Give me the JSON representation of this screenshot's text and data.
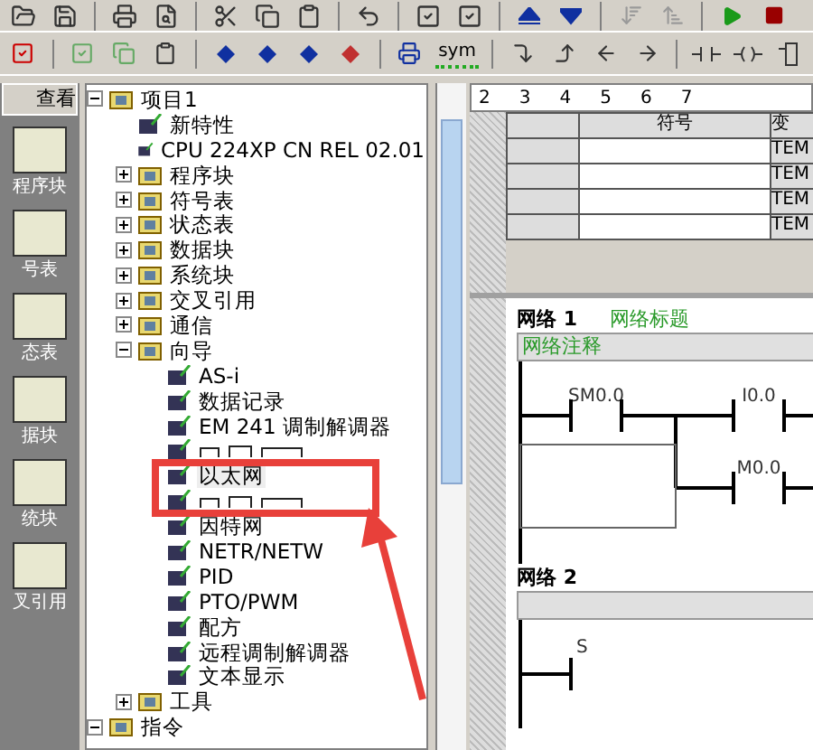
{
  "toolbar": {
    "sym_label": "sym"
  },
  "nav_bar": {
    "header": "查看",
    "items": [
      {
        "label": "程序块"
      },
      {
        "label": "号表"
      },
      {
        "label": "态表"
      },
      {
        "label": "据块"
      },
      {
        "label": "统块"
      },
      {
        "label": "叉引用"
      }
    ]
  },
  "tree": [
    {
      "label": "项目1",
      "expanded": true,
      "children": [
        {
          "label": "新特性"
        },
        {
          "label": "CPU 224XP CN REL 02.01"
        },
        {
          "label": "程序块",
          "expanded": false
        },
        {
          "label": "符号表",
          "expanded": false
        },
        {
          "label": "状态表",
          "expanded": false
        },
        {
          "label": "数据块",
          "expanded": false
        },
        {
          "label": "系统块",
          "expanded": false
        },
        {
          "label": "交叉引用",
          "expanded": false
        },
        {
          "label": "通信",
          "expanded": false
        },
        {
          "label": "向导",
          "expanded": true,
          "children": [
            {
              "label": "AS-i"
            },
            {
              "label": "数据记录"
            },
            {
              "label": "EM 241 调制解调器"
            },
            {
              "kind": "covered"
            },
            {
              "label": "以太网",
              "highlighted": true
            },
            {
              "kind": "covered"
            },
            {
              "label": "因特网"
            },
            {
              "label": "NETR/NETW"
            },
            {
              "label": "PID"
            },
            {
              "label": "PTO/PWM"
            },
            {
              "label": "配方"
            },
            {
              "label": "远程调制解调器"
            },
            {
              "label": "文本显示"
            }
          ]
        },
        {
          "label": "工具",
          "expanded": false
        }
      ]
    },
    {
      "label": "指令",
      "expanded": true
    }
  ],
  "ruler": {
    "ticks": [
      "2",
      "3",
      "4",
      "5",
      "6",
      "7"
    ]
  },
  "variable_table": {
    "columns": [
      "符号",
      "变"
    ],
    "rows": [
      "TEM",
      "TEM",
      "TEM",
      "TEM"
    ]
  },
  "networks": [
    {
      "kind": "branch",
      "title": "网络 1",
      "name": "网络标题",
      "comment": "网络注释",
      "contacts": [
        "SM0.0",
        "I0.0",
        "M0.0"
      ]
    },
    {
      "kind": "single",
      "title": "网络 2",
      "contacts": [
        "S"
      ]
    }
  ]
}
